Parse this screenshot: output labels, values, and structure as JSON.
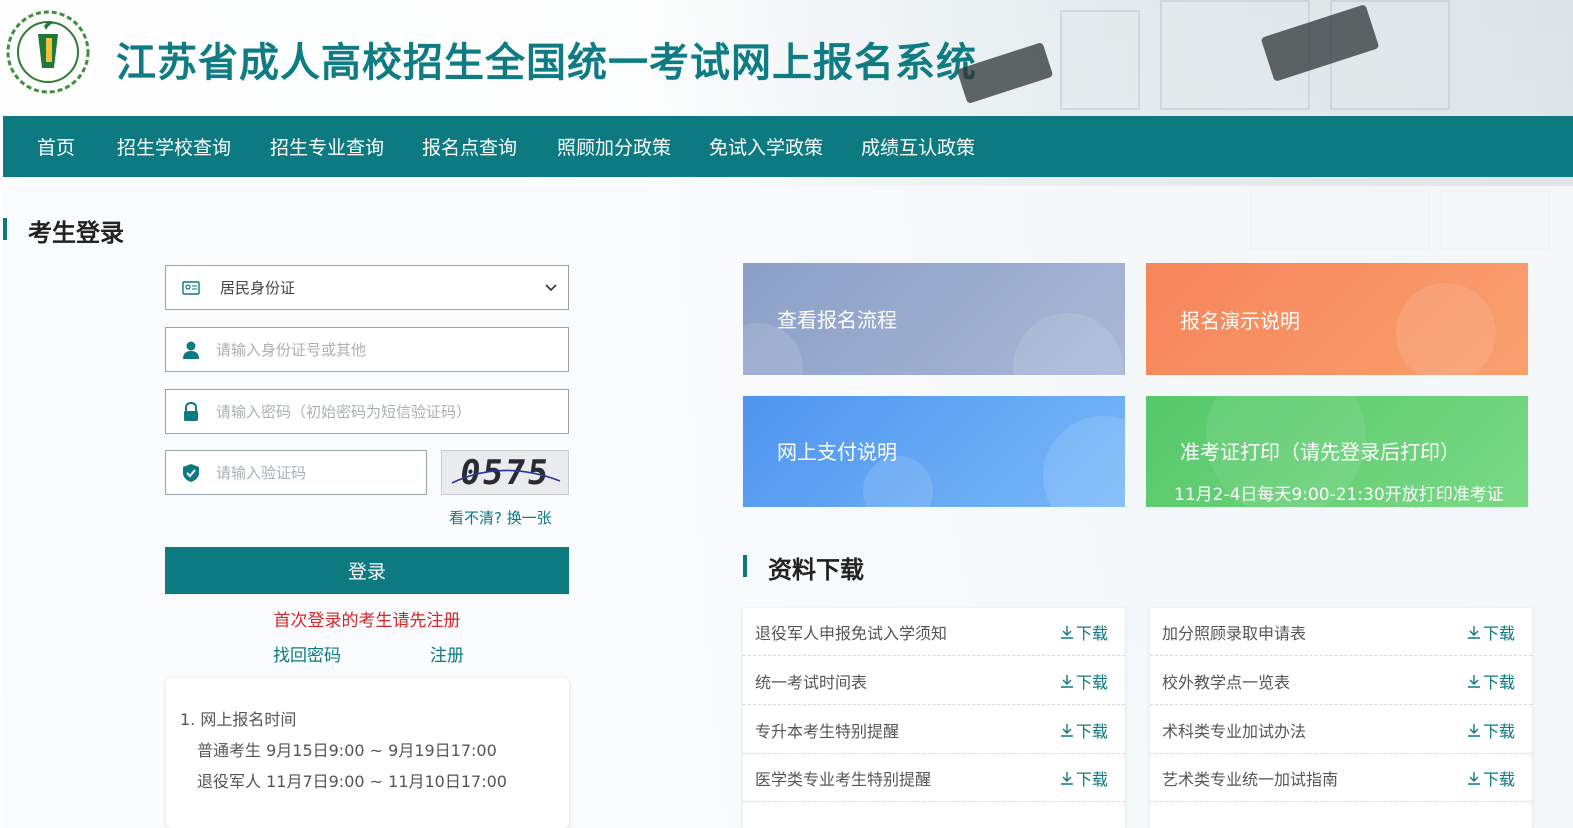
{
  "header": {
    "site_title": "江苏省成人高校招生全国统一考试网上报名系统"
  },
  "nav": {
    "items": [
      "首页",
      "招生学校查询",
      "招生专业查询",
      "报名点查询",
      "照顾加分政策",
      "免试入学政策",
      "成绩互认政策"
    ]
  },
  "login": {
    "section_title": "考生登录",
    "id_type_selected": "居民身份证",
    "id_placeholder": "请输入身份证号或其他",
    "password_placeholder": "请输入密码（初始密码为短信验证码）",
    "captcha_placeholder": "请输入验证码",
    "captcha_text": "0575",
    "refresh_captcha": "看不清? 换一张",
    "login_button": "登录",
    "first_login_notice": "首次登录的考生请先注册",
    "forgot_password": "找回密码",
    "register": "注册"
  },
  "info": {
    "line1": "1. 网上报名时间",
    "line2": "普通考生 9月15日9:00 ~ 9月19日17:00",
    "line3": "退役军人 11月7日9:00 ~ 11月10日17:00"
  },
  "tiles": {
    "process": "查看报名流程",
    "demo": "报名演示说明",
    "payment": "网上支付说明",
    "admission_print": "准考证打印（请先登录后打印）",
    "admission_print_sub": "11月2-4日每天9:00-21:30开放打印准考证"
  },
  "downloads": {
    "section_title": "资料下载",
    "download_label": "下载",
    "left": [
      "退役军人申报免试入学须知",
      "统一考试时间表",
      "专升本考生特别提醒",
      "医学类专业考生特别提醒"
    ],
    "right": [
      "加分照顾录取申请表",
      "校外教学点一览表",
      "术科类专业加试办法",
      "艺术类专业统一加试指南"
    ]
  },
  "colors": {
    "brand": "#0c7a80",
    "notice_red": "#d3282b",
    "tile_process": "#8ea3c6",
    "tile_demo": "#f6895c",
    "tile_payment": "#5aa2f0",
    "tile_print": "#5fce72"
  }
}
